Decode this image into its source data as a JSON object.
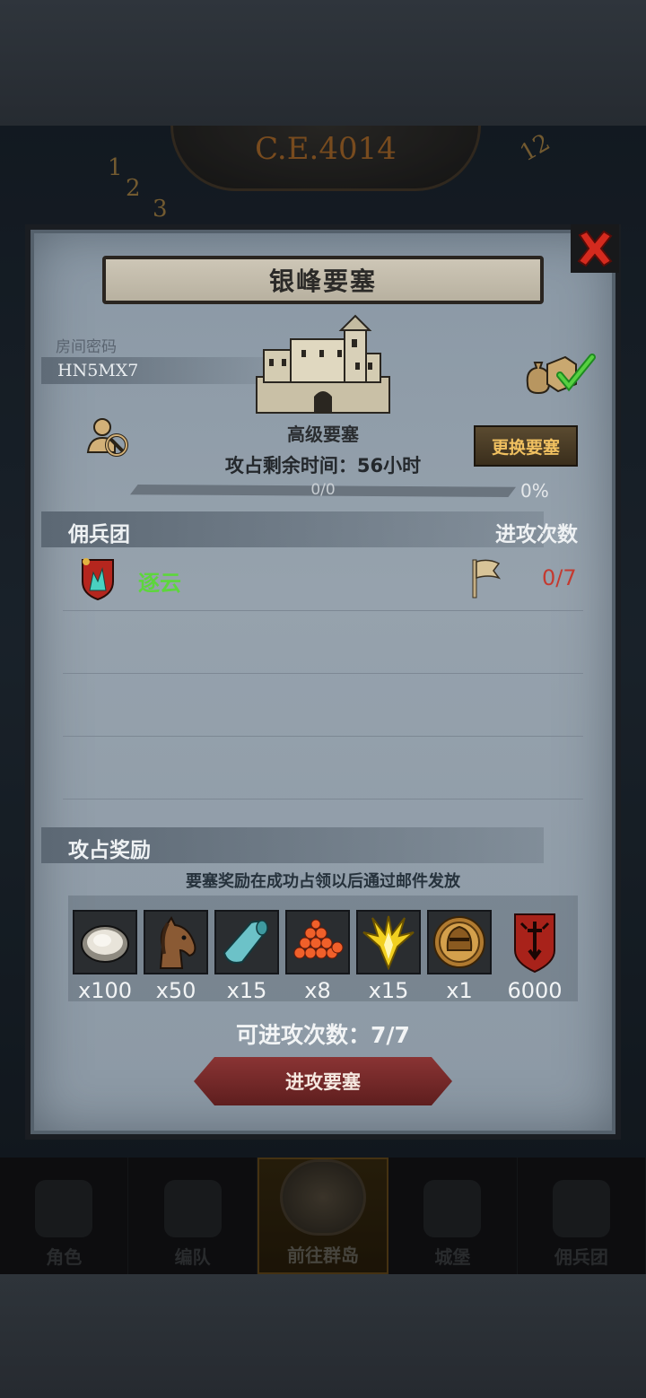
{
  "background": {
    "year": "C.E.4014",
    "clock_numbers": [
      "12",
      "1",
      "2",
      "3"
    ]
  },
  "panel": {
    "title": "银峰要塞",
    "password_label": "房间密码",
    "password_value": "HN5MX7",
    "fort_type": "高级要塞",
    "time_remaining": "攻占剩余时间：56小时",
    "progress_text": "0/0",
    "progress_percent": "0%",
    "progress_fraction": 0,
    "change_button": "更换要塞",
    "close_icon": "close-x-icon"
  },
  "mercenary": {
    "section_title": "佣兵团",
    "attacks_header": "进攻次数",
    "rows": [
      {
        "name": "逐云",
        "count": "0/7"
      }
    ]
  },
  "rewards": {
    "section_title": "攻占奖励",
    "note": "要塞奖励在成功占领以后通过邮件发放",
    "items": [
      {
        "icon": "oyster-icon",
        "qty": "x100"
      },
      {
        "icon": "horse-icon",
        "qty": "x50"
      },
      {
        "icon": "cloth-icon",
        "qty": "x15"
      },
      {
        "icon": "roe-icon",
        "qty": "x8"
      },
      {
        "icon": "gold-crystal-icon",
        "qty": "x15"
      },
      {
        "icon": "knight-medal-icon",
        "qty": "x1"
      },
      {
        "icon": "guild-banner-icon",
        "qty": "6000"
      }
    ],
    "attempts": "可进攻次数：7/7",
    "attack_button": "进攻要塞"
  },
  "navbar": {
    "items": [
      {
        "label": "角色",
        "active": false
      },
      {
        "label": "编队",
        "active": false
      },
      {
        "label": "前往群岛",
        "active": true
      },
      {
        "label": "城堡",
        "active": false
      },
      {
        "label": "佣兵团",
        "active": false
      }
    ]
  },
  "colors": {
    "panel": "#96a2ad",
    "merc_name": "#5dd63c",
    "merc_count": "#c43a30",
    "change_btn_text": "#f0c060",
    "attack_btn": "#8a3434"
  }
}
